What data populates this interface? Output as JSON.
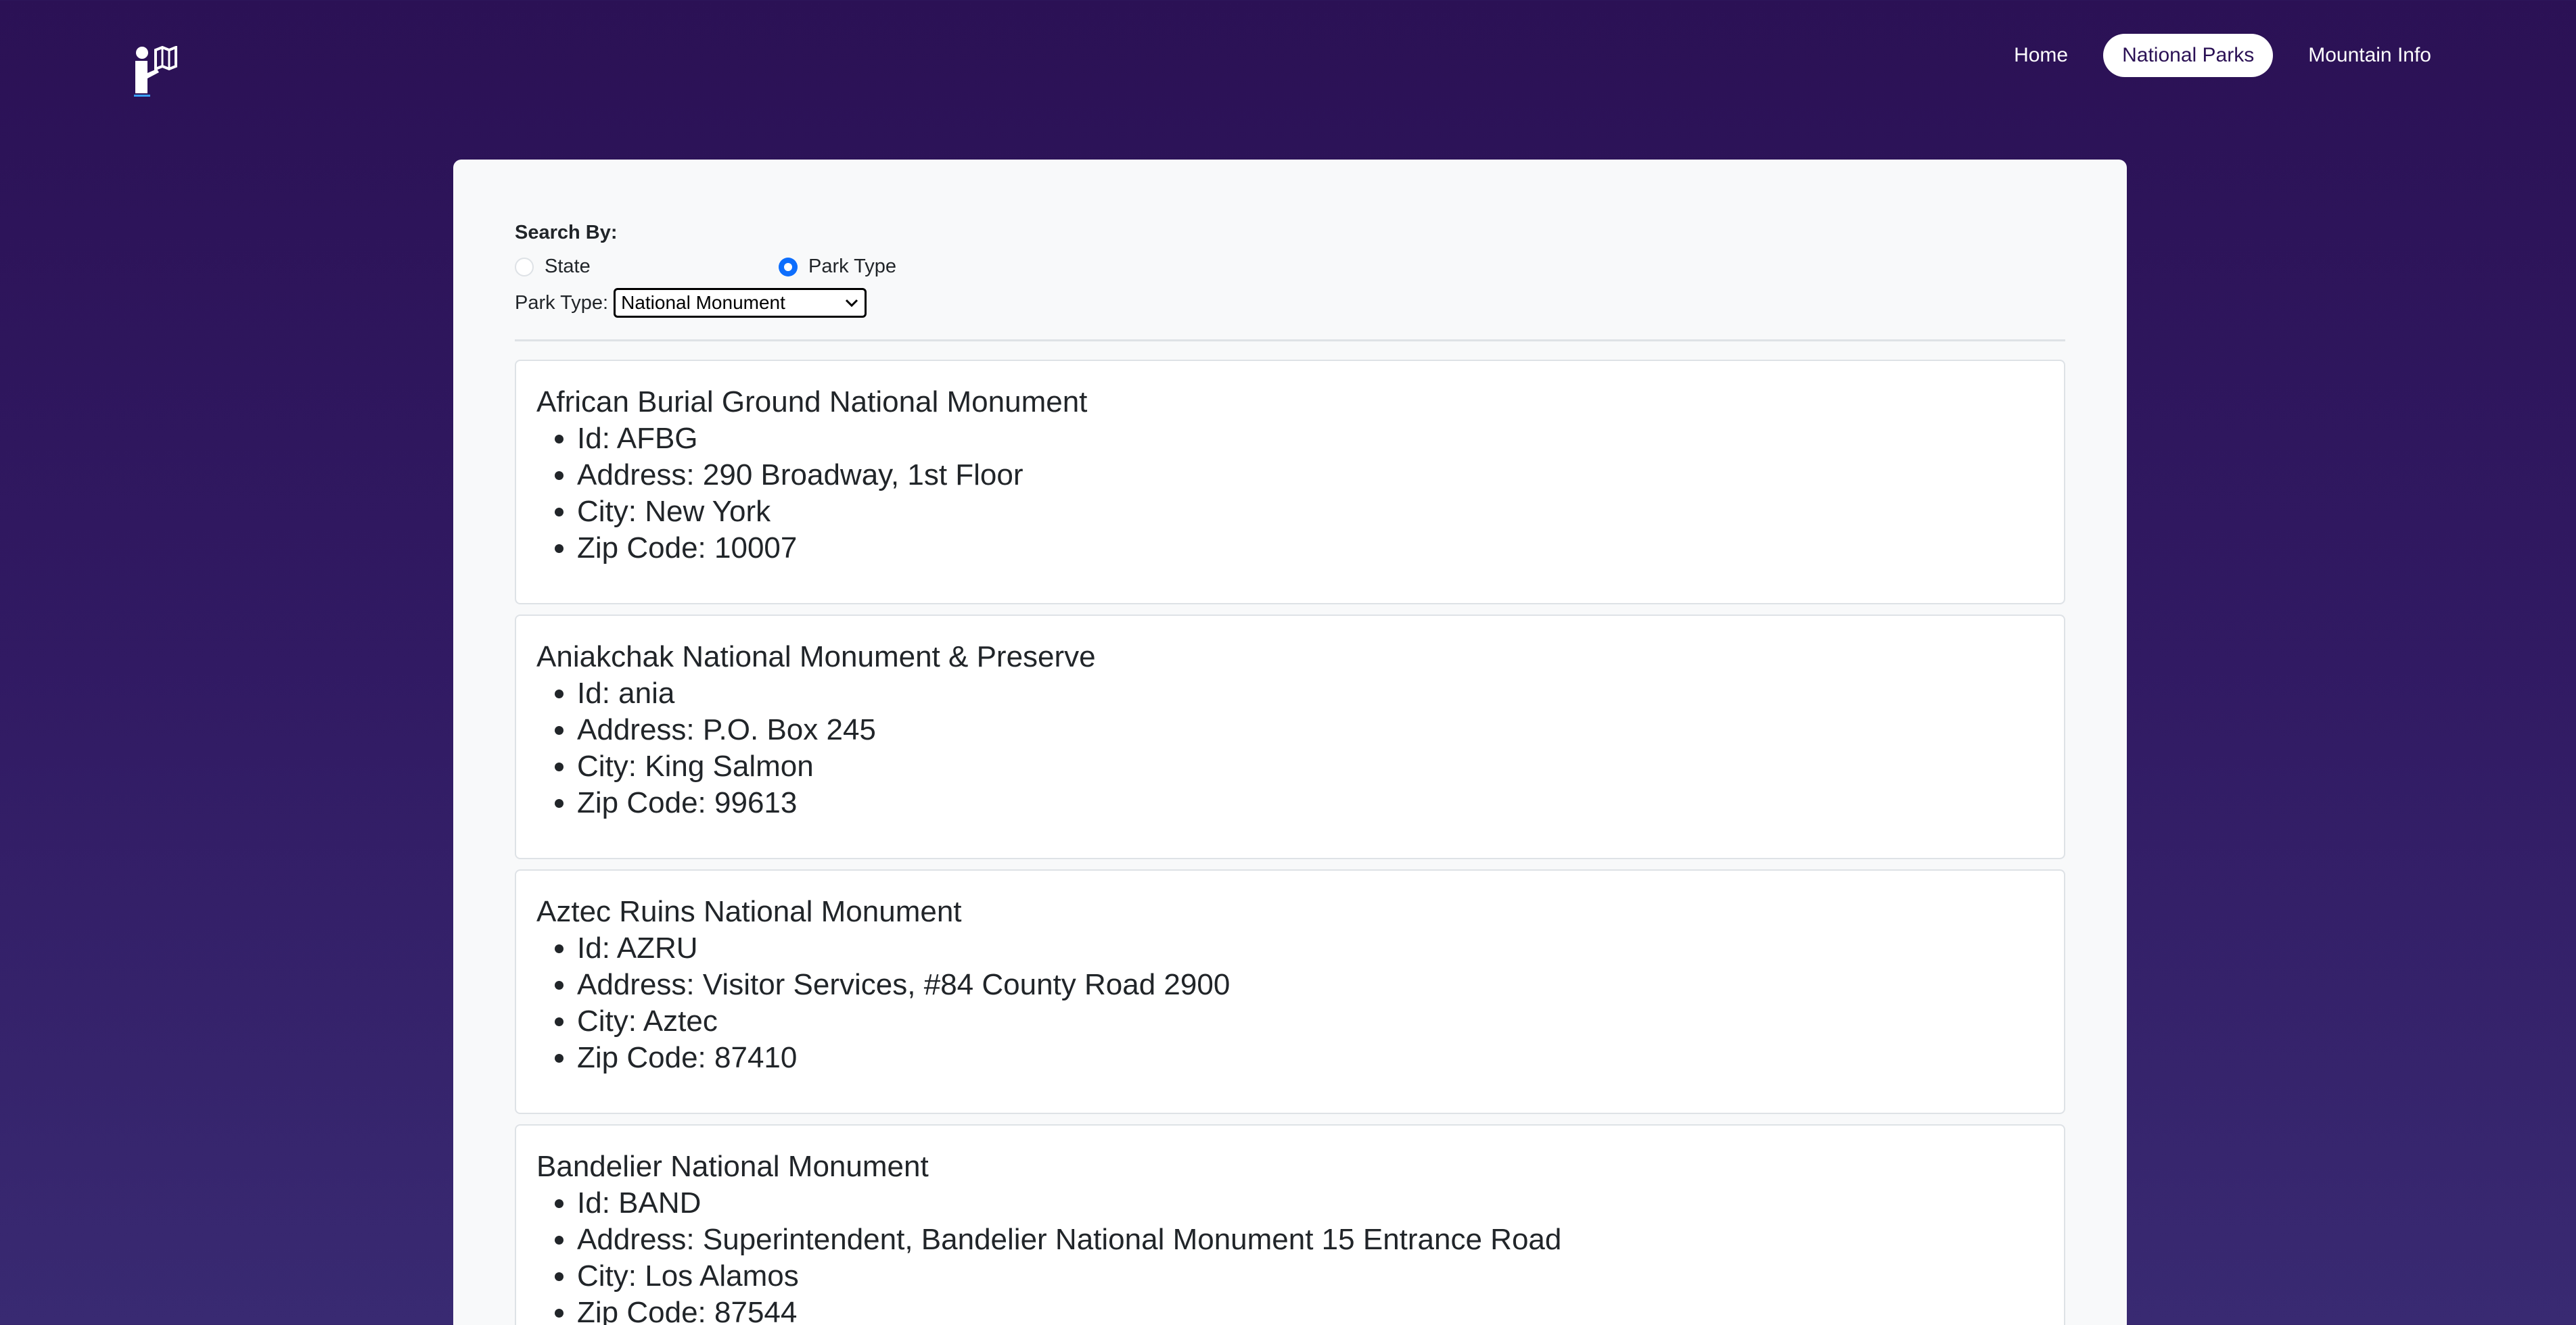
{
  "nav": {
    "logo_icon": "reader-map-icon",
    "links": [
      {
        "label": "Home",
        "active": false
      },
      {
        "label": "National Parks",
        "active": true
      },
      {
        "label": "Mountain Info",
        "active": false
      }
    ]
  },
  "search": {
    "heading": "Search By:",
    "options": [
      {
        "label": "State",
        "checked": false
      },
      {
        "label": "Park Type",
        "checked": true
      }
    ],
    "park_type_label": "Park Type:",
    "park_type_value": "National Monument"
  },
  "fields": {
    "id": "Id:",
    "address": "Address:",
    "city": "City:",
    "zip": "Zip Code:"
  },
  "parks": [
    {
      "name": "African Burial Ground National Monument",
      "id": "AFBG",
      "address": "290 Broadway, 1st Floor",
      "city": "New York",
      "zip": "10007"
    },
    {
      "name": "Aniakchak National Monument & Preserve",
      "id": "ania",
      "address": "P.O. Box 245",
      "city": "King Salmon",
      "zip": "99613"
    },
    {
      "name": "Aztec Ruins National Monument",
      "id": "AZRU",
      "address": "Visitor Services, #84 County Road 2900",
      "city": "Aztec",
      "zip": "87410"
    },
    {
      "name": "Bandelier National Monument",
      "id": "BAND",
      "address": "Superintendent, Bandelier National Monument 15 Entrance Road",
      "city": "Los Alamos",
      "zip": "87544"
    }
  ],
  "colors": {
    "background_top": "#2b1155",
    "panel": "#f8f9fa",
    "accent": "#0d6efd"
  }
}
